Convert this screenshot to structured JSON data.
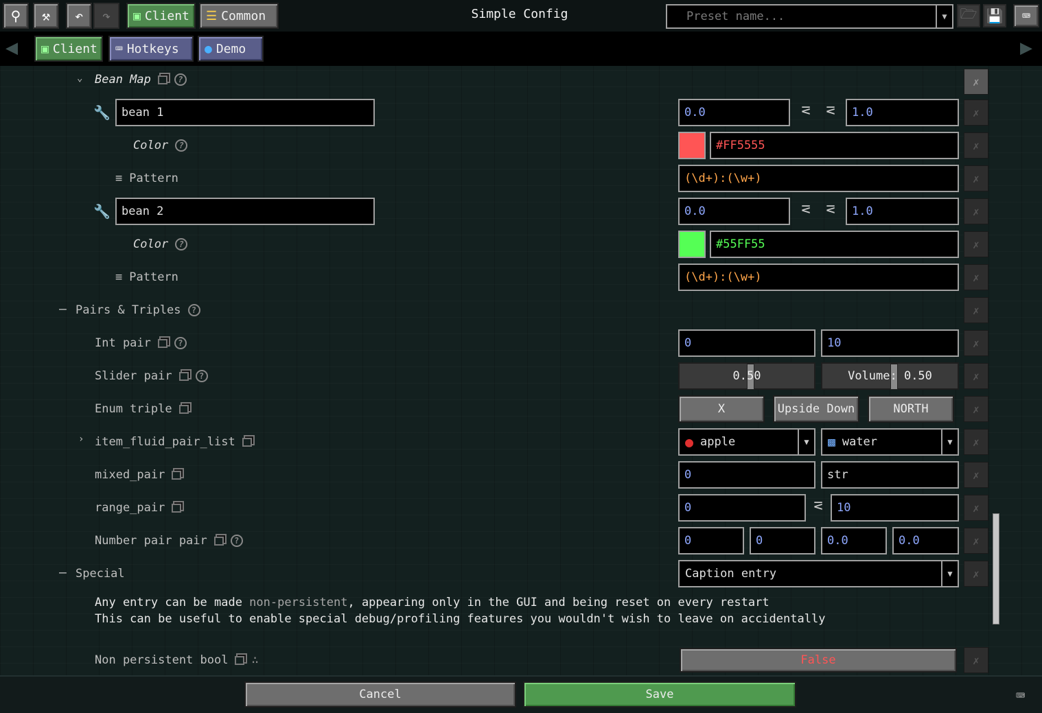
{
  "toolbar": {
    "search_icon": "search-icon",
    "edit_icon": "hammer-icon",
    "undo_icon": "undo-icon",
    "redo_icon": "redo-icon",
    "tab_client": "Client",
    "tab_common": "Common",
    "title": "Simple Config",
    "preset_placeholder": "Preset name..."
  },
  "tabs": {
    "client": "Client",
    "hotkeys": "Hotkeys",
    "demo": "Demo"
  },
  "bean_map": {
    "label": "Bean Map",
    "beans": [
      {
        "name": "bean 1",
        "min": "0.0",
        "max": "1.0",
        "color_label": "Color",
        "color": "#FF5555",
        "pattern_label": "Pattern",
        "pattern": "(\\d+):(\\w+)"
      },
      {
        "name": "bean 2",
        "min": "0.0",
        "max": "1.0",
        "color_label": "Color",
        "color": "#55FF55",
        "pattern_label": "Pattern",
        "pattern": "(\\d+):(\\w+)"
      }
    ]
  },
  "pairs": {
    "section_label": "Pairs & Triples",
    "int_pair": {
      "label": "Int pair",
      "a": "0",
      "b": "10"
    },
    "slider_pair": {
      "label": "Slider pair",
      "a": "0.50",
      "b": "Volume: 0.50",
      "a_level": 0.5,
      "b_level": 0.5
    },
    "enum_triple": {
      "label": "Enum triple",
      "a": "X",
      "b": "Upside Down",
      "c": "NORTH"
    },
    "item_fluid_pair_list": {
      "label": "item_fluid_pair_list",
      "item": "apple",
      "fluid": "water"
    },
    "mixed_pair": {
      "label": "mixed_pair",
      "a": "0",
      "b": "str"
    },
    "range_pair": {
      "label": "range_pair",
      "a": "0",
      "b": "10"
    },
    "number_pair_pair": {
      "label": "Number pair pair",
      "a": "0",
      "b": "0",
      "c": "0.0",
      "d": "0.0"
    }
  },
  "special": {
    "section_label": "Special",
    "caption_entry": "Caption entry",
    "note_line1_pre": "Any entry can be made ",
    "note_line1_hl": "non-persistent",
    "note_line1_post": ", appearing only in the GUI and being reset on every restart",
    "note_line2": "This can be useful to enable special debug/profiling features you wouldn't wish to leave on accidentally",
    "non_persistent_bool": {
      "label": "Non persistent bool",
      "value": "False"
    }
  },
  "footer": {
    "cancel": "Cancel",
    "save": "Save"
  },
  "colors": {
    "accent_green": "#4F9A4F",
    "false_red": "#FF5555",
    "number_blue": "#8FA8FF"
  }
}
